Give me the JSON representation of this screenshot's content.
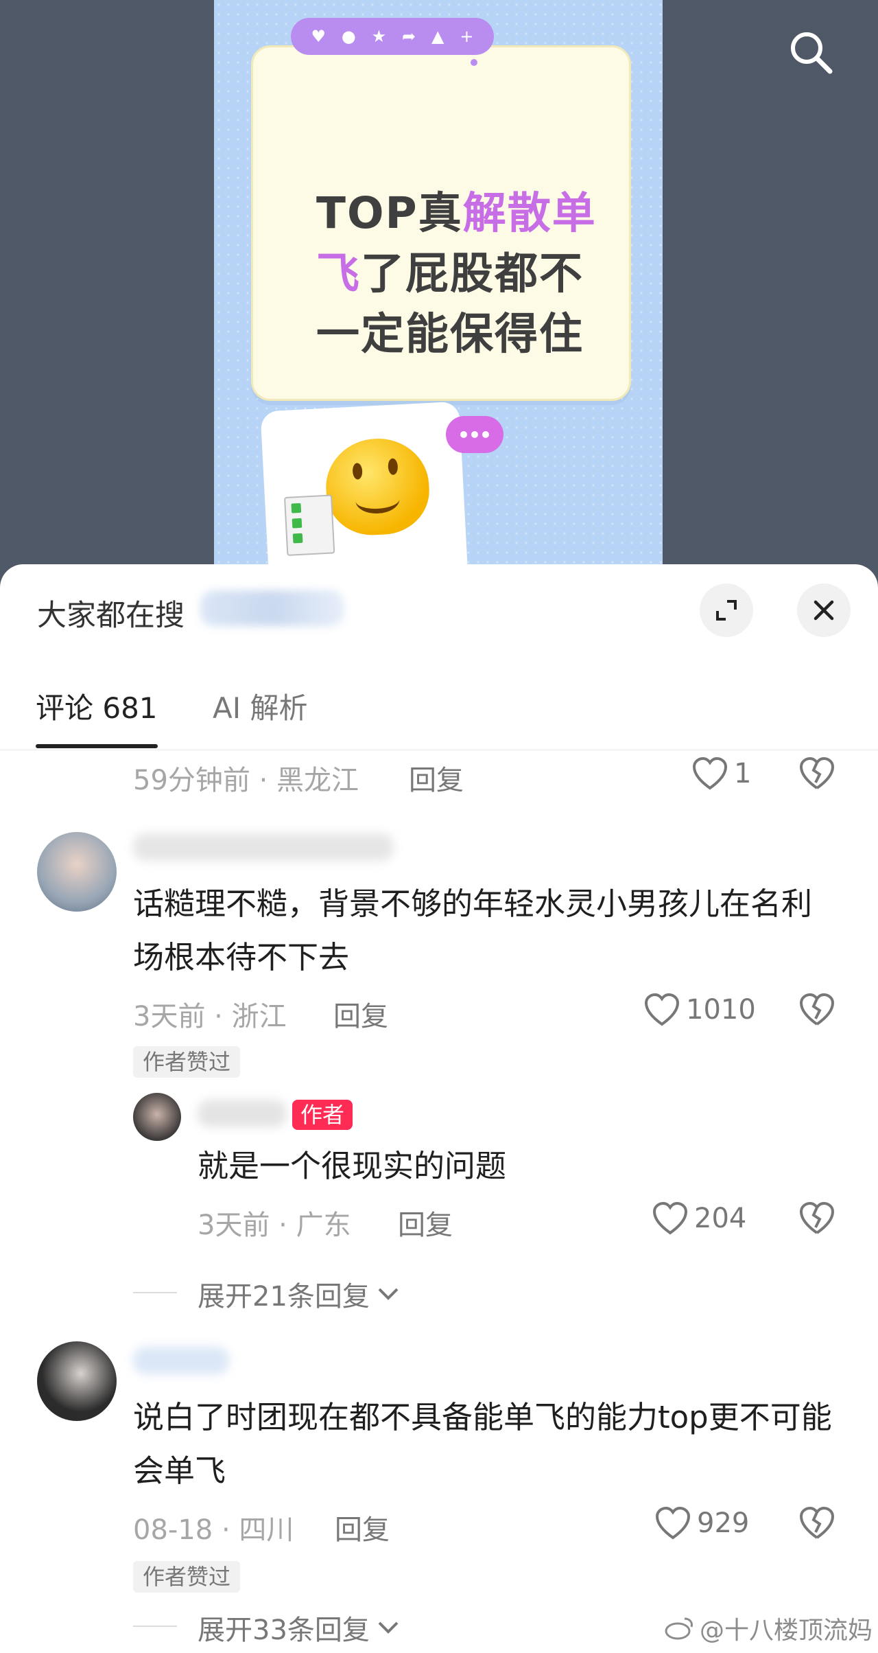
{
  "poster": {
    "line1_a": "TOP真",
    "line1_b": "解散单",
    "line2_a": "飞",
    "line2_b": "了屁股都不",
    "line3": "一定能保得住",
    "pill_icons": [
      "♥",
      "💬",
      "★",
      "➦",
      "👍",
      "+"
    ]
  },
  "sheet": {
    "search_hint": "大家都在搜",
    "tabs": [
      {
        "label": "评论 681",
        "active": true
      },
      {
        "label": "AI 解析",
        "active": false
      }
    ]
  },
  "comments": [
    {
      "time_location": "59分钟前 · 黑龙江",
      "reply_label": "回复",
      "likes": "1"
    },
    {
      "text": "话糙理不糙，背景不够的年轻水灵小男孩儿在名利场根本待不下去",
      "time_location": "3天前 · 浙江",
      "reply_label": "回复",
      "likes": "1010",
      "author_liked": "作者赞过",
      "reply": {
        "badge": "作者",
        "text": "就是一个很现实的问题",
        "time_location": "3天前 · 广东",
        "reply_label": "回复",
        "likes": "204"
      },
      "expand_label": "展开21条回复"
    },
    {
      "text": "说白了时团现在都不具备能单飞的能力top更不可能会单飞",
      "time_location": "08-18 · 四川",
      "reply_label": "回复",
      "likes": "929",
      "author_liked": "作者赞过",
      "expand_label": "展开33条回复"
    }
  ],
  "watermark": "@十八楼顶流妈",
  "colors": {
    "accent_red": "#fe2c55",
    "poster_purple": "#c76de6",
    "poster_bg": "#b7d4f7"
  }
}
